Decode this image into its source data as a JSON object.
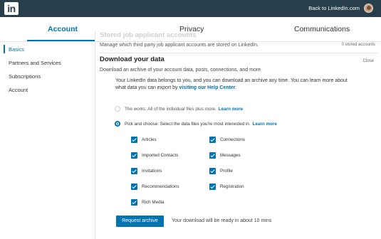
{
  "topbar": {
    "logo": "in",
    "back_link": "Back to LinkedIn.com"
  },
  "tabs": [
    {
      "label": "Account",
      "active": true
    },
    {
      "label": "Privacy",
      "active": false
    },
    {
      "label": "Communications",
      "active": false
    }
  ],
  "sidebar": {
    "items": [
      {
        "label": "Basics",
        "active": true
      },
      {
        "label": "Partners and Services",
        "active": false
      },
      {
        "label": "Subscriptions",
        "active": false
      },
      {
        "label": "Account",
        "active": false
      }
    ]
  },
  "stored": {
    "title": "Stored job applicant accounts",
    "description": "Manage which third party job applicant accounts are stored on LinkedIn.",
    "count": "0 stored accounts"
  },
  "download": {
    "title": "Download your data",
    "close": "Close",
    "subtitle": "Download an archive of your account data, posts, connections, and more",
    "info_text": "Your LinkedIn data belongs to you, and you can download an archive any time. You can learn more about what data you can export by",
    "info_link": "visiting our Help Center",
    "info_end": ".",
    "option_works": "The works: All of the individual files plus more.",
    "option_pick": "Pick and choose: Select the data files you're most interested in.",
    "learn_more": "Learn more",
    "checkboxes_left": [
      "Articles",
      "Imported Contacts",
      "Invitations",
      "Recommendations",
      "Rich Media"
    ],
    "checkboxes_right": [
      "Connections",
      "Messages",
      "Profile",
      "Registration"
    ],
    "button": "Request archive",
    "ready_text": "Your download will be ready in about 10 mins"
  },
  "colors": {
    "brand": "#0073b1",
    "topbar": "#283e4a"
  }
}
